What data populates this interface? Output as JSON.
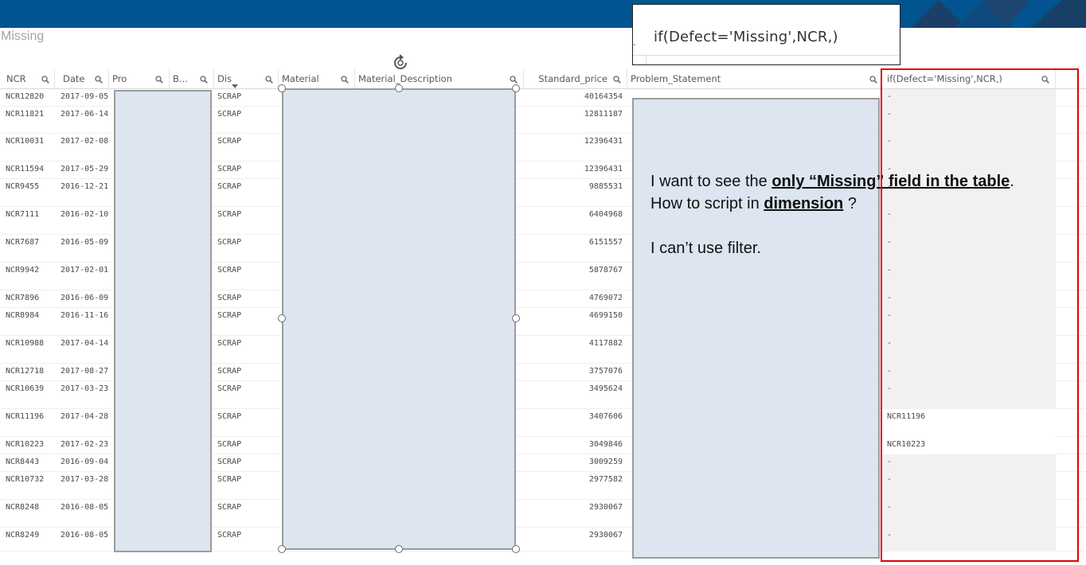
{
  "sheet": {
    "title": "Missing"
  },
  "callout": {
    "expression": "if(Defect='Missing',NCR,)",
    "marker": "."
  },
  "columns": [
    {
      "key": "ncr",
      "label": "NCR"
    },
    {
      "key": "date",
      "label": "Date"
    },
    {
      "key": "pro",
      "label": "Pro"
    },
    {
      "key": "b",
      "label": "B..."
    },
    {
      "key": "dis",
      "label": "Dis"
    },
    {
      "key": "material",
      "label": "Material"
    },
    {
      "key": "material_description",
      "label": "Material_Description"
    },
    {
      "key": "standard_price",
      "label": "Standard_price"
    },
    {
      "key": "problem_statement",
      "label": "Problem_Statement"
    },
    {
      "key": "if_col",
      "label": "if(Defect='Missing',NCR,)"
    }
  ],
  "rows": [
    {
      "ncr": "NCR12820",
      "date": "2017-09-05",
      "dis": "SCRAP",
      "price": "40164354",
      "if": "-"
    },
    {
      "ncr": "NCR11821",
      "date": "2017-06-14",
      "dis": "SCRAP",
      "price": "12811187",
      "if": "-"
    },
    {
      "ncr": "NCR10031",
      "date": "2017-02-08",
      "dis": "SCRAP",
      "price": "12396431",
      "if": "-"
    },
    {
      "ncr": "NCR11594",
      "date": "2017-05-29",
      "dis": "SCRAP",
      "price": "12396431",
      "if": "-"
    },
    {
      "ncr": "NCR9455",
      "date": "2016-12-21",
      "dis": "SCRAP",
      "price": "9885531",
      "if": "-"
    },
    {
      "ncr": "NCR7111",
      "date": "2016-02-10",
      "dis": "SCRAP",
      "price": "6404968",
      "if": "-"
    },
    {
      "ncr": "NCR7687",
      "date": "2016-05-09",
      "dis": "SCRAP",
      "price": "6151557",
      "if": "-"
    },
    {
      "ncr": "NCR9942",
      "date": "2017-02-01",
      "dis": "SCRAP",
      "price": "5878767",
      "if": "-"
    },
    {
      "ncr": "NCR7896",
      "date": "2016-06-09",
      "dis": "SCRAP",
      "price": "4769072",
      "if": "-"
    },
    {
      "ncr": "NCR8984",
      "date": "2016-11-16",
      "dis": "SCRAP",
      "price": "4699150",
      "if": "-"
    },
    {
      "ncr": "NCR10988",
      "date": "2017-04-14",
      "dis": "SCRAP",
      "price": "4117882",
      "if": "-"
    },
    {
      "ncr": "NCR12718",
      "date": "2017-08-27",
      "dis": "SCRAP",
      "price": "3757076",
      "if": "-"
    },
    {
      "ncr": "NCR10639",
      "date": "2017-03-23",
      "dis": "SCRAP",
      "price": "3495624",
      "if": "-"
    },
    {
      "ncr": "NCR11196",
      "date": "2017-04-28",
      "dis": "SCRAP",
      "price": "3407606",
      "if": "NCR11196"
    },
    {
      "ncr": "NCR10223",
      "date": "2017-02-23",
      "dis": "SCRAP",
      "price": "3049846",
      "if": "NCR10223"
    },
    {
      "ncr": "NCR8443",
      "date": "2016-09-04",
      "dis": "SCRAP",
      "price": "3009259",
      "if": "-"
    },
    {
      "ncr": "NCR10732",
      "date": "2017-03-28",
      "dis": "SCRAP",
      "price": "2977582",
      "if": "-"
    },
    {
      "ncr": "NCR8248",
      "date": "2016-08-05",
      "dis": "SCRAP",
      "price": "2930067",
      "if": "-"
    },
    {
      "ncr": "NCR8249",
      "date": "2016-08-05",
      "dis": "SCRAP",
      "price": "2930067",
      "if": "-"
    }
  ],
  "note": {
    "line1_pre": "I want to see the ",
    "line1_bold": "only “Missing” field in the table",
    "line1_post": ".",
    "line2_pre": "How to script in ",
    "line2_bold": "dimension",
    "line2_post": " ?",
    "line3": "I can’t use filter."
  },
  "colors": {
    "topbar": "#015490",
    "highlight": "#e10000",
    "redaction": "#dce5f0"
  }
}
